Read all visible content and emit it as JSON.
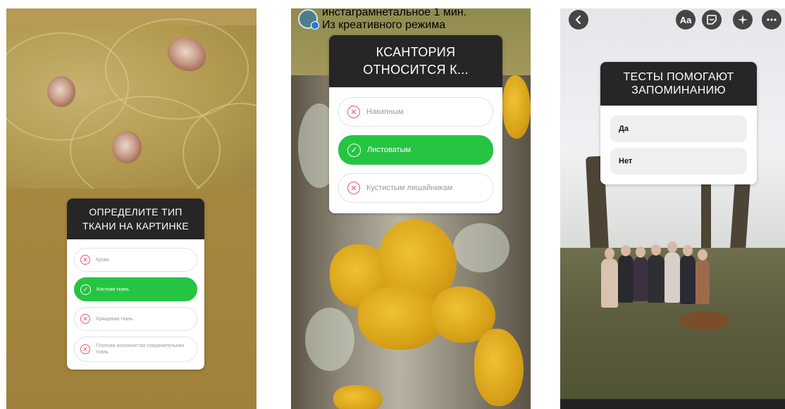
{
  "story1": {
    "question": "ОПРЕДЕЛИТЕ ТИП ТКАНИ НА КАРТИНКЕ",
    "options": [
      {
        "label": "Кровь",
        "state": "wrong"
      },
      {
        "label": "Костная ткань",
        "state": "correct"
      },
      {
        "label": "Хрящевая ткань",
        "state": "wrong"
      },
      {
        "label": "Плотная волокнистая соединительная ткань",
        "state": "wrong"
      }
    ]
  },
  "story2": {
    "header": {
      "username": "инстаграмнетальное",
      "time": "1 мин.",
      "subtitle": "Из креативного режима"
    },
    "question": "КСАНТОРИЯ ОТНОСИТСЯ К...",
    "options": [
      {
        "label": "Накипным",
        "state": "wrong"
      },
      {
        "label": "Листоватым",
        "state": "correct"
      },
      {
        "label": "Кустистым лишайникам",
        "state": "wrong"
      }
    ]
  },
  "story3": {
    "toolbar": {
      "back_icon": "chevron-left-icon",
      "text_label": "Aa",
      "sticker_icon": "sticker-icon",
      "effects_icon": "sparkles-icon",
      "more_icon": "more-icon"
    },
    "question": "ТЕСТЫ ПОМОГАЮТ ЗАПОМИНАНИЮ",
    "options": [
      {
        "label": "Да"
      },
      {
        "label": "Нет"
      }
    ]
  },
  "colors": {
    "correct": "#26c443",
    "wrong_mark": "#e45a6a",
    "title_bg": "#262626"
  }
}
